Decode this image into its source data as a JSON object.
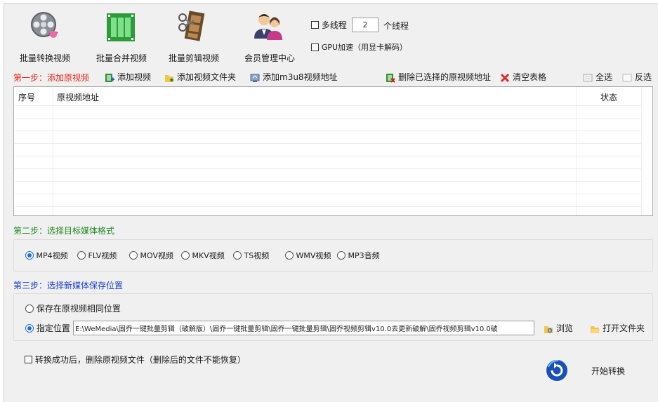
{
  "toolbar": {
    "batch_convert": "批量转换视频",
    "batch_merge": "批量合并视频",
    "batch_edit": "批量剪辑视频",
    "member_center": "会员管理中心"
  },
  "options": {
    "multithread_label": "多线程",
    "thread_count": "2",
    "thread_unit": "个线程",
    "gpu_label": "GPU加速（用显卡解码）"
  },
  "step1": {
    "title": "第一步：添加原视频",
    "add_video": "添加视频",
    "add_folder": "添加视频文件夹",
    "add_m3u8": "添加m3u8视频地址",
    "delete_selected": "删除已选择的原视频地址",
    "clear_table": "清空表格",
    "select_all": "全选",
    "invert": "反选"
  },
  "table": {
    "columns": [
      "序号",
      "原视频地址",
      "状态"
    ],
    "rows": []
  },
  "step2": {
    "title": "第二步：选择目标媒体格式",
    "formats": [
      "MP4视频",
      "FLV视频",
      "MOV视频",
      "MKV视频",
      "TS视频",
      "WMV视频",
      "MP3音频"
    ],
    "selected": "MP4视频"
  },
  "step3": {
    "title": "第三步：选择新媒体保存位置",
    "same_location": "保存在原视频相同位置",
    "custom_location": "指定位置",
    "path": "E:\\WeMedia\\固乔一键批量剪辑（破解版）\\固乔一键批量剪辑\\固乔一键批量剪辑\\固乔视频剪辑v10.0去更新破解\\固乔视频剪辑v10.0破",
    "browse": "浏览",
    "open_folder": "打开文件夹"
  },
  "footer": {
    "delete_after": "转换成功后，删除原视频文件（删除后的文件不能恢复）",
    "start": "开始转换"
  },
  "colors": {
    "step1": "#e8261a",
    "step2": "#1f8a1f",
    "step3": "#1a3fd1",
    "radio_on": "#1e6fd9"
  }
}
